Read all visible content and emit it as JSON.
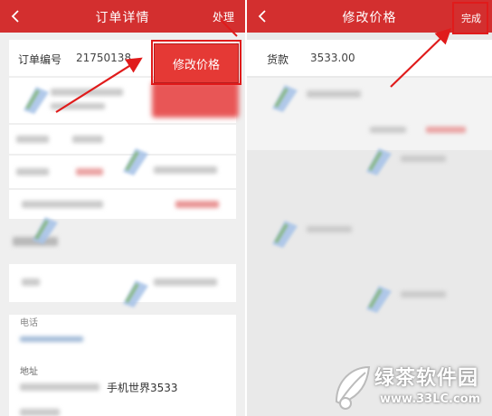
{
  "left": {
    "header": {
      "title": "订单详情",
      "action": "处理"
    },
    "order_number": {
      "label": "订单编号",
      "value": "21750138"
    },
    "popup_button": "修改价格",
    "fields": [
      {
        "label": "电话"
      },
      {
        "label": "地址",
        "value": "手机世界3533"
      }
    ]
  },
  "right": {
    "header": {
      "title": "修改价格",
      "action": "完成"
    },
    "price": {
      "label": "货款",
      "value": "3533.00"
    }
  },
  "watermark": {
    "text": "绿茶软件园",
    "url": "www.33LC.com"
  },
  "colors": {
    "header_red": "#d32f2f",
    "highlight_red": "#e01b1b",
    "button_red": "#e53935"
  }
}
